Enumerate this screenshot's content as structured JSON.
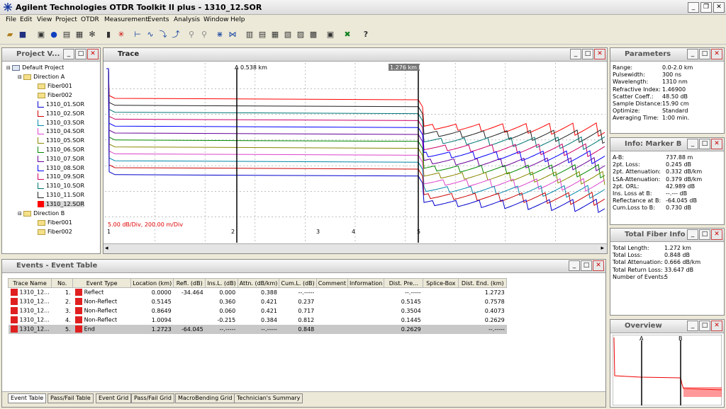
{
  "app": {
    "title": "Agilent Technologies OTDR Toolkit II plus - 1310_12.SOR"
  },
  "menu": [
    "File",
    "Edit",
    "View",
    "Project",
    "OTDR",
    "Measurement",
    "Events",
    "Analysis",
    "Window",
    "Help"
  ],
  "project_panel": {
    "title": "Project V...",
    "root": "Default Project",
    "dir_a": "Direction A",
    "dir_b": "Direction B",
    "a_fibers": [
      "Fiber001",
      "Fiber002"
    ],
    "traces": [
      {
        "label": "1310_01.SOR",
        "color": "#0000cc"
      },
      {
        "label": "1310_02.SOR",
        "color": "#cc0000"
      },
      {
        "label": "1310_03.SOR",
        "color": "#0088aa"
      },
      {
        "label": "1310_04.SOR",
        "color": "#dd44cc"
      },
      {
        "label": "1310_05.SOR",
        "color": "#888800"
      },
      {
        "label": "1310_06.SOR",
        "color": "#008800"
      },
      {
        "label": "1310_07.SOR",
        "color": "#660099"
      },
      {
        "label": "1310_08.SOR",
        "color": "#0000ff"
      },
      {
        "label": "1310_09.SOR",
        "color": "#cc0066"
      },
      {
        "label": "1310_10.SOR",
        "color": "#007777"
      },
      {
        "label": "1310_11.SOR",
        "color": "#222222"
      },
      {
        "label": "1310_12.SOR",
        "color": "#ff0000"
      }
    ],
    "b_fibers": [
      "Fiber001",
      "Fiber002"
    ]
  },
  "trace_panel": {
    "title": "Trace",
    "marker_a": "A 0.538 km",
    "marker_b": "1.276 km B",
    "scale": "5.00 dB/Div, 200.00 m/Div",
    "event_numbers": [
      "1",
      "2",
      "3",
      "4",
      "5"
    ]
  },
  "parameters": {
    "title": "Parameters",
    "rows": [
      [
        "Range:",
        "0.0-2.0 km"
      ],
      [
        "Pulsewidth:",
        "300 ns"
      ],
      [
        "Wavelength:",
        "1310 nm"
      ],
      [
        "Refractive Index:",
        "1.46900"
      ],
      [
        "Scatter Coeff.:",
        "48.50 dB"
      ],
      [
        "Sample Distance:",
        "15.90 cm"
      ],
      [
        "Optimize:",
        "Standard"
      ],
      [
        "Averaging Time:",
        "1:00 min."
      ]
    ]
  },
  "marker_info": {
    "title": "Info: Marker B",
    "rows": [
      [
        "A-B:",
        "737.88 m"
      ],
      [
        "2pt. Loss:",
        "0.245 dB"
      ],
      [
        "2pt. Attenuation:",
        "0.332 dB/km"
      ],
      [
        "LSA-Attenuation:",
        "0.379 dB/km"
      ],
      [
        "2pt. ORL:",
        "42.989 dB"
      ],
      [
        "Ins. Loss at B:",
        "--.--- dB"
      ],
      [
        "Reflectance at B:",
        "-64.045 dB"
      ],
      [
        "Cum.Loss to B:",
        "0.730 dB"
      ]
    ]
  },
  "fiber_info": {
    "title": "Total Fiber Info",
    "rows": [
      [
        "Total Length:",
        "1.272 km"
      ],
      [
        "Total Loss:",
        "0.848 dB"
      ],
      [
        "Total Attenuation:",
        "0.666 dB/km"
      ],
      [
        "Total Return Loss:",
        "33.647 dB"
      ],
      [
        "Number of Events:",
        "5"
      ]
    ]
  },
  "overview": {
    "title": "Overview",
    "marker_a": "A",
    "marker_b": "B"
  },
  "events": {
    "title": "Events - Event Table",
    "columns": [
      "Trace Name",
      "No.",
      "Event Type",
      "Location (km)",
      "Refl. (dB)",
      "Ins.L. (dB)",
      "Attn. (dB/km)",
      "Cum.L. (dB)",
      "Comment",
      "Information",
      "Dist. Pre...",
      "Splice-Box",
      "Dist. End. (km)"
    ],
    "rows": [
      [
        "1310_12...",
        "1.",
        "Reflect",
        "0.0000",
        "-34.464",
        "0.000",
        "0.388",
        "--.-----",
        "",
        "",
        "--.-----",
        "",
        "1.2723"
      ],
      [
        "1310_12...",
        "2.",
        "Non-Reflect",
        "0.5145",
        "",
        "0.360",
        "0.421",
        "0.237",
        "",
        "",
        "0.5145",
        "",
        "0.7578"
      ],
      [
        "1310_12...",
        "3.",
        "Non-Reflect",
        "0.8649",
        "",
        "0.060",
        "0.421",
        "0.717",
        "",
        "",
        "0.3504",
        "",
        "0.4073"
      ],
      [
        "1310_12...",
        "4.",
        "Non-Reflect",
        "1.0094",
        "",
        "-0.215",
        "0.384",
        "0.812",
        "",
        "",
        "0.1445",
        "",
        "0.2629"
      ],
      [
        "1310_12...",
        "5.",
        "End",
        "1.2723",
        "-64.045",
        "--.-----",
        "--.-----",
        "0.848",
        "",
        "",
        "0.2629",
        "",
        "--.-----"
      ]
    ],
    "tabs": [
      "Event Table",
      "Pass/Fail Table",
      "Event Grid",
      "Pass/Fail Grid",
      "MacroBending Grid",
      "Technician's Summary"
    ]
  }
}
